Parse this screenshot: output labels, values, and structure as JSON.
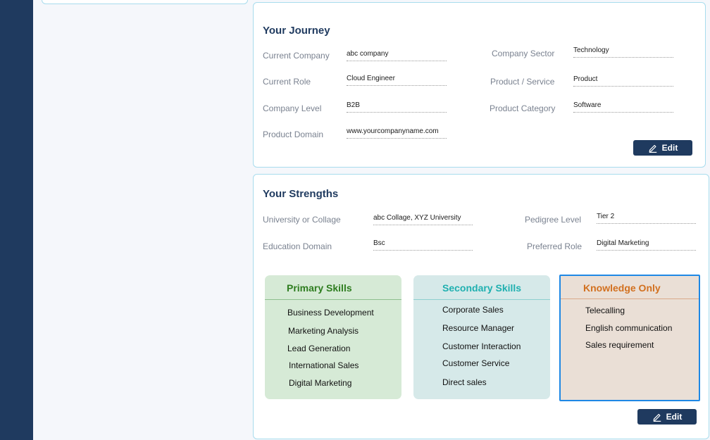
{
  "journey": {
    "title": "Your Journey",
    "fields": {
      "current_company": {
        "label": "Current Company",
        "value": "abc company"
      },
      "current_role": {
        "label": "Current Role",
        "value": "Cloud Engineer"
      },
      "company_level": {
        "label": "Company Level",
        "value": "B2B"
      },
      "product_domain": {
        "label": "Product Domain",
        "value": "www.yourcompanyname.com"
      },
      "company_sector": {
        "label": "Company Sector",
        "value": "Technology"
      },
      "product_service": {
        "label": "Product / Service",
        "value": "Product"
      },
      "product_category": {
        "label": "Product Category",
        "value": "Software"
      }
    },
    "edit_label": "Edit",
    "edit_icon": "pencil-icon"
  },
  "strengths": {
    "title": "Your Strengths",
    "fields": {
      "university": {
        "label": "University or Collage",
        "value": "abc Collage, XYZ University"
      },
      "education_domain": {
        "label": "Education Domain",
        "value": "Bsc"
      },
      "pedigree_level": {
        "label": "Pedigree Level",
        "value": "Tier 2"
      },
      "preferred_role": {
        "label": "Preferred Role",
        "value": "Digital Marketing"
      }
    },
    "primary": {
      "title": "Primary Skills",
      "items": [
        "Business  Development",
        "Marketing Analysis",
        "Lead Generation",
        "International Sales",
        "Digital Marketing"
      ]
    },
    "secondary": {
      "title": "Secondary Skills",
      "items": [
        "Corporate Sales",
        "Resource Manager",
        "Customer Interaction",
        "Customer Service",
        "Direct sales"
      ]
    },
    "knowledge": {
      "title": "Knowledge Only",
      "items": [
        "Telecalling",
        "English communication",
        "Sales requirement"
      ]
    },
    "edit_label": "Edit",
    "edit_icon": "pencil-icon"
  },
  "colors": {
    "sidebar": "#1f3a5f",
    "primary_bg": "#d6ead6",
    "primary_title": "#2e7d1f",
    "secondary_bg": "#d6e9e9",
    "secondary_title": "#1fb0b0",
    "knowledge_bg": "#eadfd6",
    "knowledge_title": "#d2701f",
    "knowledge_border": "#1e88e5"
  }
}
